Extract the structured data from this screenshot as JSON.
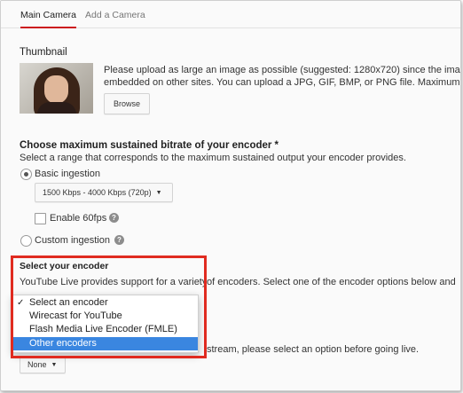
{
  "tabs": {
    "main": "Main Camera",
    "add": "Add a Camera"
  },
  "thumbnail": {
    "heading": "Thumbnail",
    "desc_line1": "Please upload as large an image as possible (suggested: 1280x720) since the ima",
    "desc_line2": "embedded on other sites. You can upload a JPG, GIF, BMP, or PNG file. Maximum f",
    "browse_label": "Browse"
  },
  "bitrate": {
    "heading": "Choose maximum sustained bitrate of your encoder *",
    "subtext": "Select a range that corresponds to the maximum sustained output your encoder provides.",
    "basic_label": "Basic ingestion",
    "basic_selected": true,
    "rate_select_value": "1500 Kbps - 4000 Kbps (720p)",
    "enable60_label": "Enable 60fps",
    "custom_label": "Custom ingestion"
  },
  "encoder": {
    "heading": "Select your encoder",
    "desc_left": "YouTube Live provides support for a variety",
    "desc_right": "of encoders. Select one of the encoder options below and",
    "options": [
      "Select an encoder",
      "Wirecast for YouTube",
      "Flash Media Live Encoder (FMLE)",
      "Other encoders"
    ],
    "checked_index": 0,
    "highlighted_index": 3,
    "check_glyph": "✓",
    "bottom_text": "stream, please select an option before going live.",
    "none_select_value": "None"
  },
  "colors": {
    "accent_red": "#cc181e",
    "highlight_box": "#e02b20",
    "selection_blue": "#3a86e0"
  }
}
